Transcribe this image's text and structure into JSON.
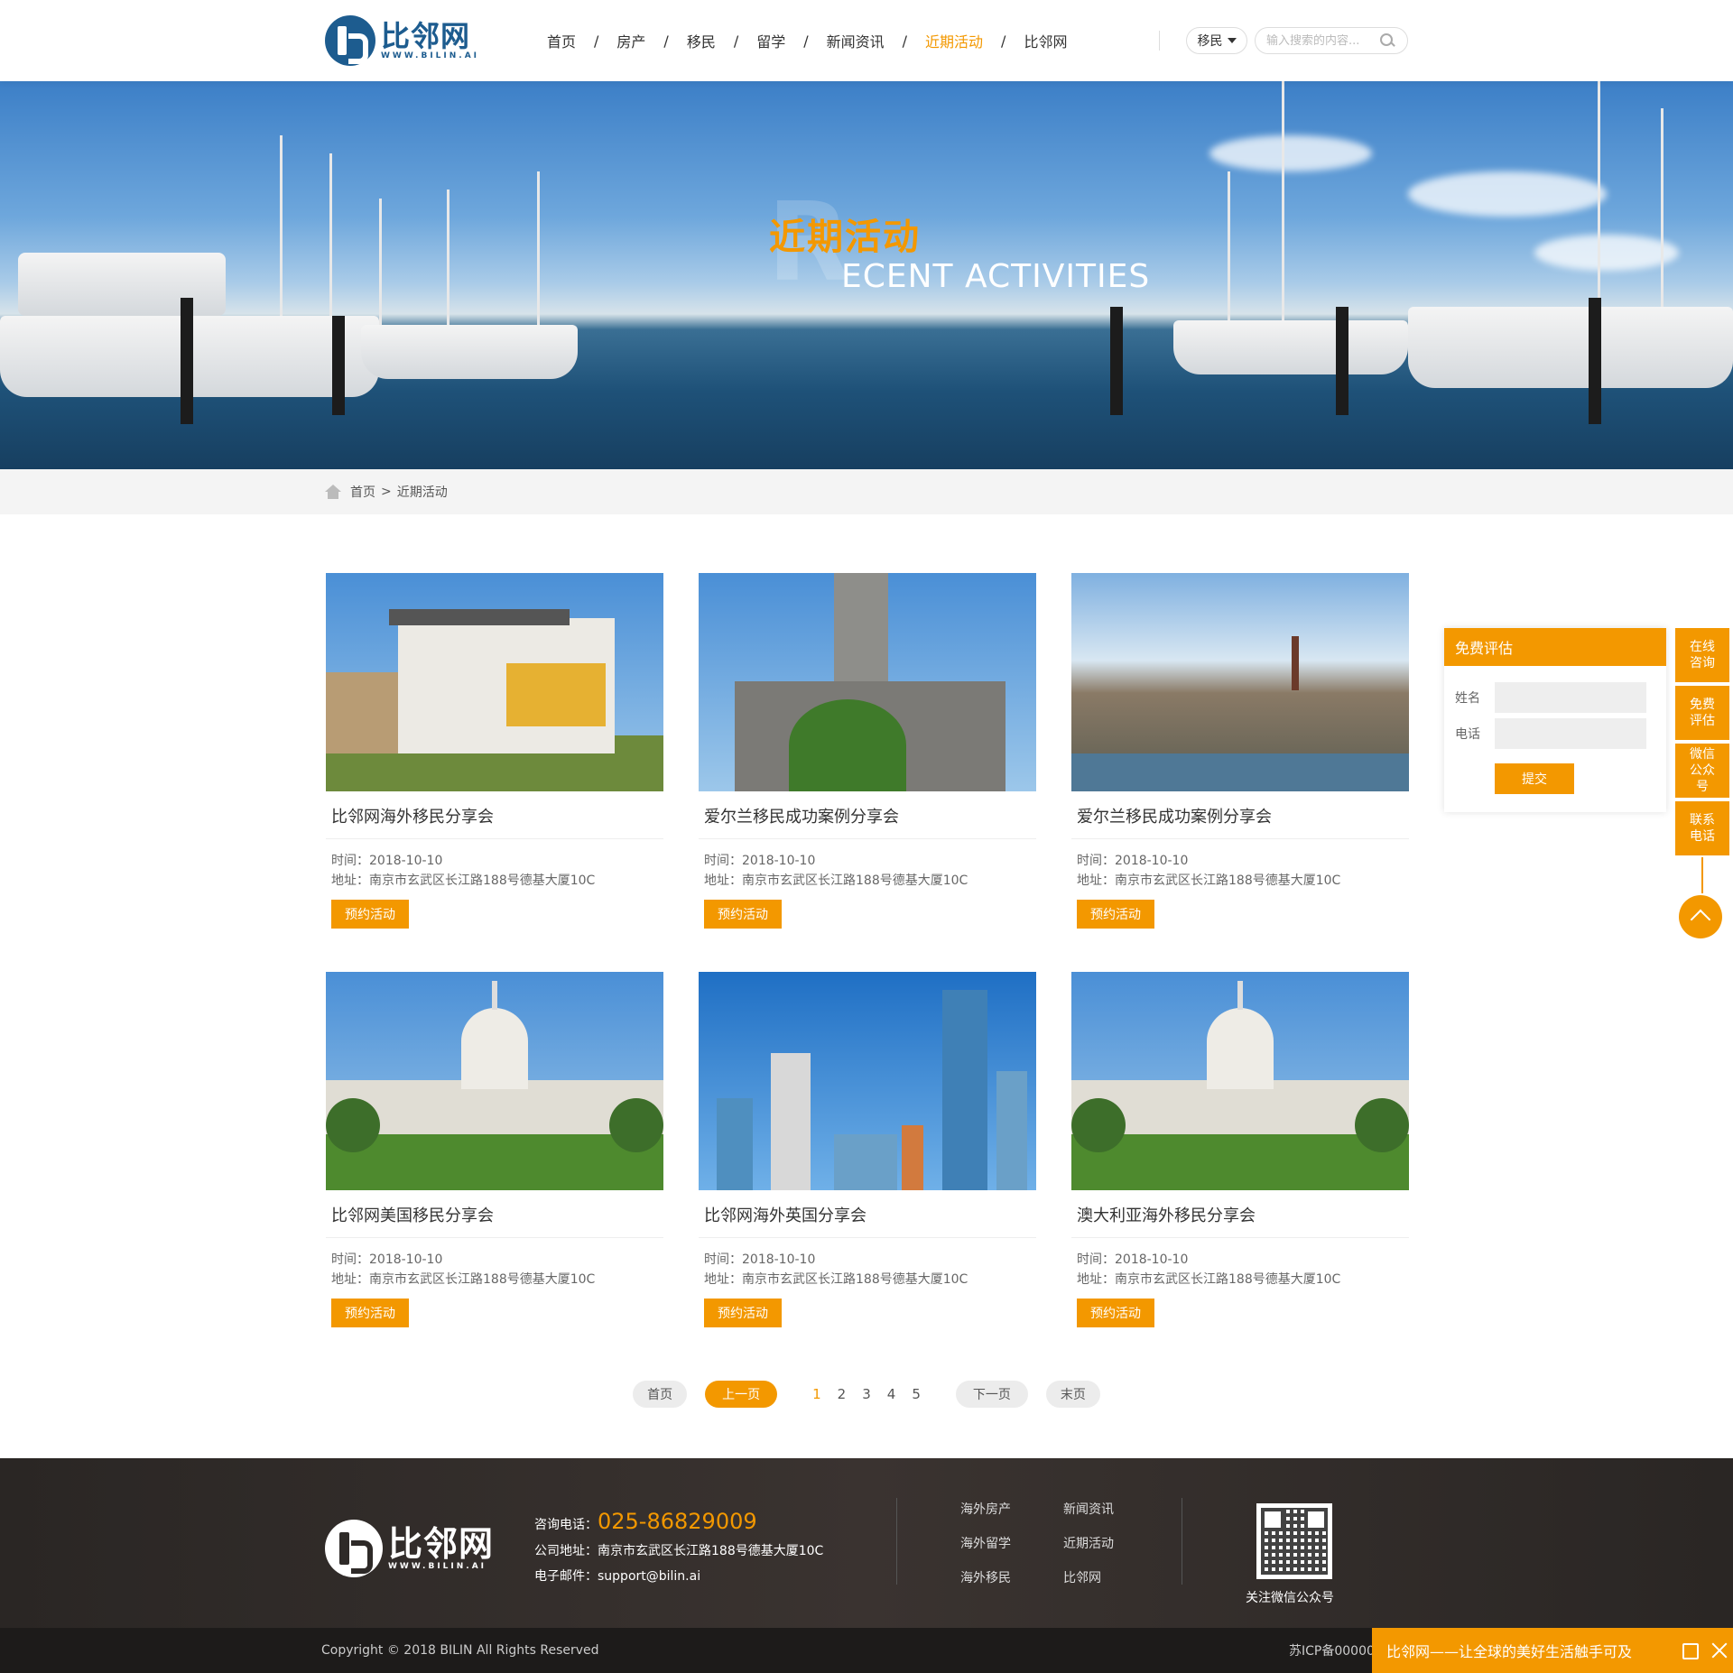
{
  "header": {
    "logo_cn": "比邻网",
    "logo_en": "WWW.BILIN.AI",
    "nav": [
      "首页",
      "房产",
      "移民",
      "留学",
      "新闻资讯",
      "近期活动",
      "比邻网"
    ],
    "nav_active_index": 5,
    "nav_separator": "/",
    "search_category": "移民",
    "search_placeholder": "输入搜索的内容..."
  },
  "banner": {
    "title": "近期活动",
    "letter": "R",
    "subtitle": "ECENT ACTIVITIES"
  },
  "breadcrumb": {
    "home": "首页",
    "separator": ">",
    "current": "近期活动"
  },
  "events": [
    {
      "title": "比邻网海外移民分享会",
      "time": "时间：2018-10-10",
      "address": "地址：南京市玄武区长江路188号德基大厦10C",
      "button": "预约活动",
      "scene": "villa"
    },
    {
      "title": "爱尔兰移民成功案例分享会",
      "time": "时间：2018-10-10",
      "address": "地址：南京市玄武区长江路188号德基大厦10C",
      "button": "预约活动",
      "scene": "church"
    },
    {
      "title": "爱尔兰移民成功案例分享会",
      "time": "时间：2018-10-10",
      "address": "地址：南京市玄武区长江路188号德基大厦10C",
      "button": "预约活动",
      "scene": "city"
    },
    {
      "title": "比邻网美国移民分享会",
      "time": "时间：2018-10-10",
      "address": "地址：南京市玄武区长江路188号德基大厦10C",
      "button": "预约活动",
      "scene": "capitol"
    },
    {
      "title": "比邻网海外英国分享会",
      "time": "时间：2018-10-10",
      "address": "地址：南京市玄武区长江路188号德基大厦10C",
      "button": "预约活动",
      "scene": "skyline"
    },
    {
      "title": "澳大利亚海外移民分享会",
      "time": "时间：2018-10-10",
      "address": "地址：南京市玄武区长江路188号德基大厦10C",
      "button": "预约活动",
      "scene": "capitol"
    }
  ],
  "pagination": {
    "first": "首页",
    "prev": "上一页",
    "pages": [
      "1",
      "2",
      "3",
      "4",
      "5"
    ],
    "current": "1",
    "next": "下一页",
    "last": "末页"
  },
  "eval_form": {
    "title": "免费评估",
    "name_label": "姓名",
    "phone_label": "电话",
    "submit": "提交"
  },
  "side_tabs": [
    "在线咨询",
    "免费评估",
    "微信公众号",
    "联系电话"
  ],
  "footer": {
    "logo_cn": "比邻网",
    "logo_en": "WWW.BILIN.AI",
    "phone_label": "咨询电话：",
    "phone": "025-86829009",
    "address": "公司地址：南京市玄武区长江路188号德基大厦10C",
    "email": "电子邮件：support@bilin.ai",
    "links": [
      "海外房产",
      "新闻资讯",
      "海外留学",
      "近期活动",
      "海外移民",
      "比邻网"
    ],
    "qr_caption": "关注微信公众号",
    "copyright": "Copyright © 2018 BILIN All Rights Reserved",
    "icp": "苏ICP备00000",
    "slogan": "比邻网——让全球的美好生活触手可及"
  },
  "colors": {
    "accent": "#f39800",
    "brand_blue": "#1d5c8f",
    "footer_bg": "#2e2a28"
  }
}
